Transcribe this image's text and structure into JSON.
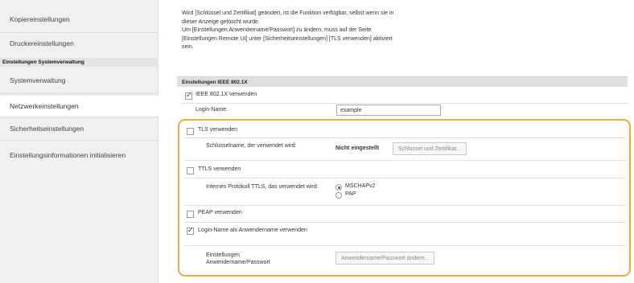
{
  "sidebar": {
    "items": [
      {
        "label": "Kopiereinstellungen"
      },
      {
        "label": "Druckereinstellungen"
      },
      {
        "label": "Systemverwaltung"
      },
      {
        "label": "Netzwerkeinstellungen"
      },
      {
        "label": "Sicherheitseinstellungen"
      },
      {
        "label": "Einstellungsinformationen initialisieren"
      }
    ],
    "header": "Einstellungen Systemverwaltung"
  },
  "intro": {
    "line1": "Wird [Schlüssel und Zertifikat] geändert, ist die Funktion verfügbar, selbst wenn sie in",
    "line2": "dieser Anzeige gelöscht wurde.",
    "line3": "Um [Einstellungen Anwendername/Passwort] zu ändern, muss auf der Seite",
    "line4": "[Einstellungen Remote UI] unter [Sicherheitseinstellungen] [TLS verwenden] aktiviert",
    "line5": "sein."
  },
  "section": {
    "title": "Einstellungen IEEE 802.1X"
  },
  "form": {
    "ieee_label": "IEEE 802.1X verwenden",
    "ieee_checked": true,
    "login_name_label": "Login-Name:",
    "login_name_value": "example",
    "tls_label": "TLS verwenden",
    "tls_checked": false,
    "key_name_label": "Schlüsselname, der verwendet wird:",
    "key_status": "Nicht eingestellt",
    "key_button": "Schlüssel und Zertifikat...",
    "ttls_label": "TTLS verwenden",
    "ttls_checked": false,
    "ttls_protocol_label": "Internes Protokoll TTLS, das verwendet wird:",
    "radio_mschap": "MSCHAPv2",
    "radio_pap": "PAP",
    "radio_selected": "MSCHAPv2",
    "peap_label": "PEAP verwenden",
    "peap_checked": false,
    "login_as_user_label": "Login-Name als Anwendername verwenden",
    "login_as_user_checked": true,
    "user_pw_label": "Einstellungen Anwendername/Passwort",
    "user_pw_button": "Anwendername/Passwort ändern..."
  }
}
